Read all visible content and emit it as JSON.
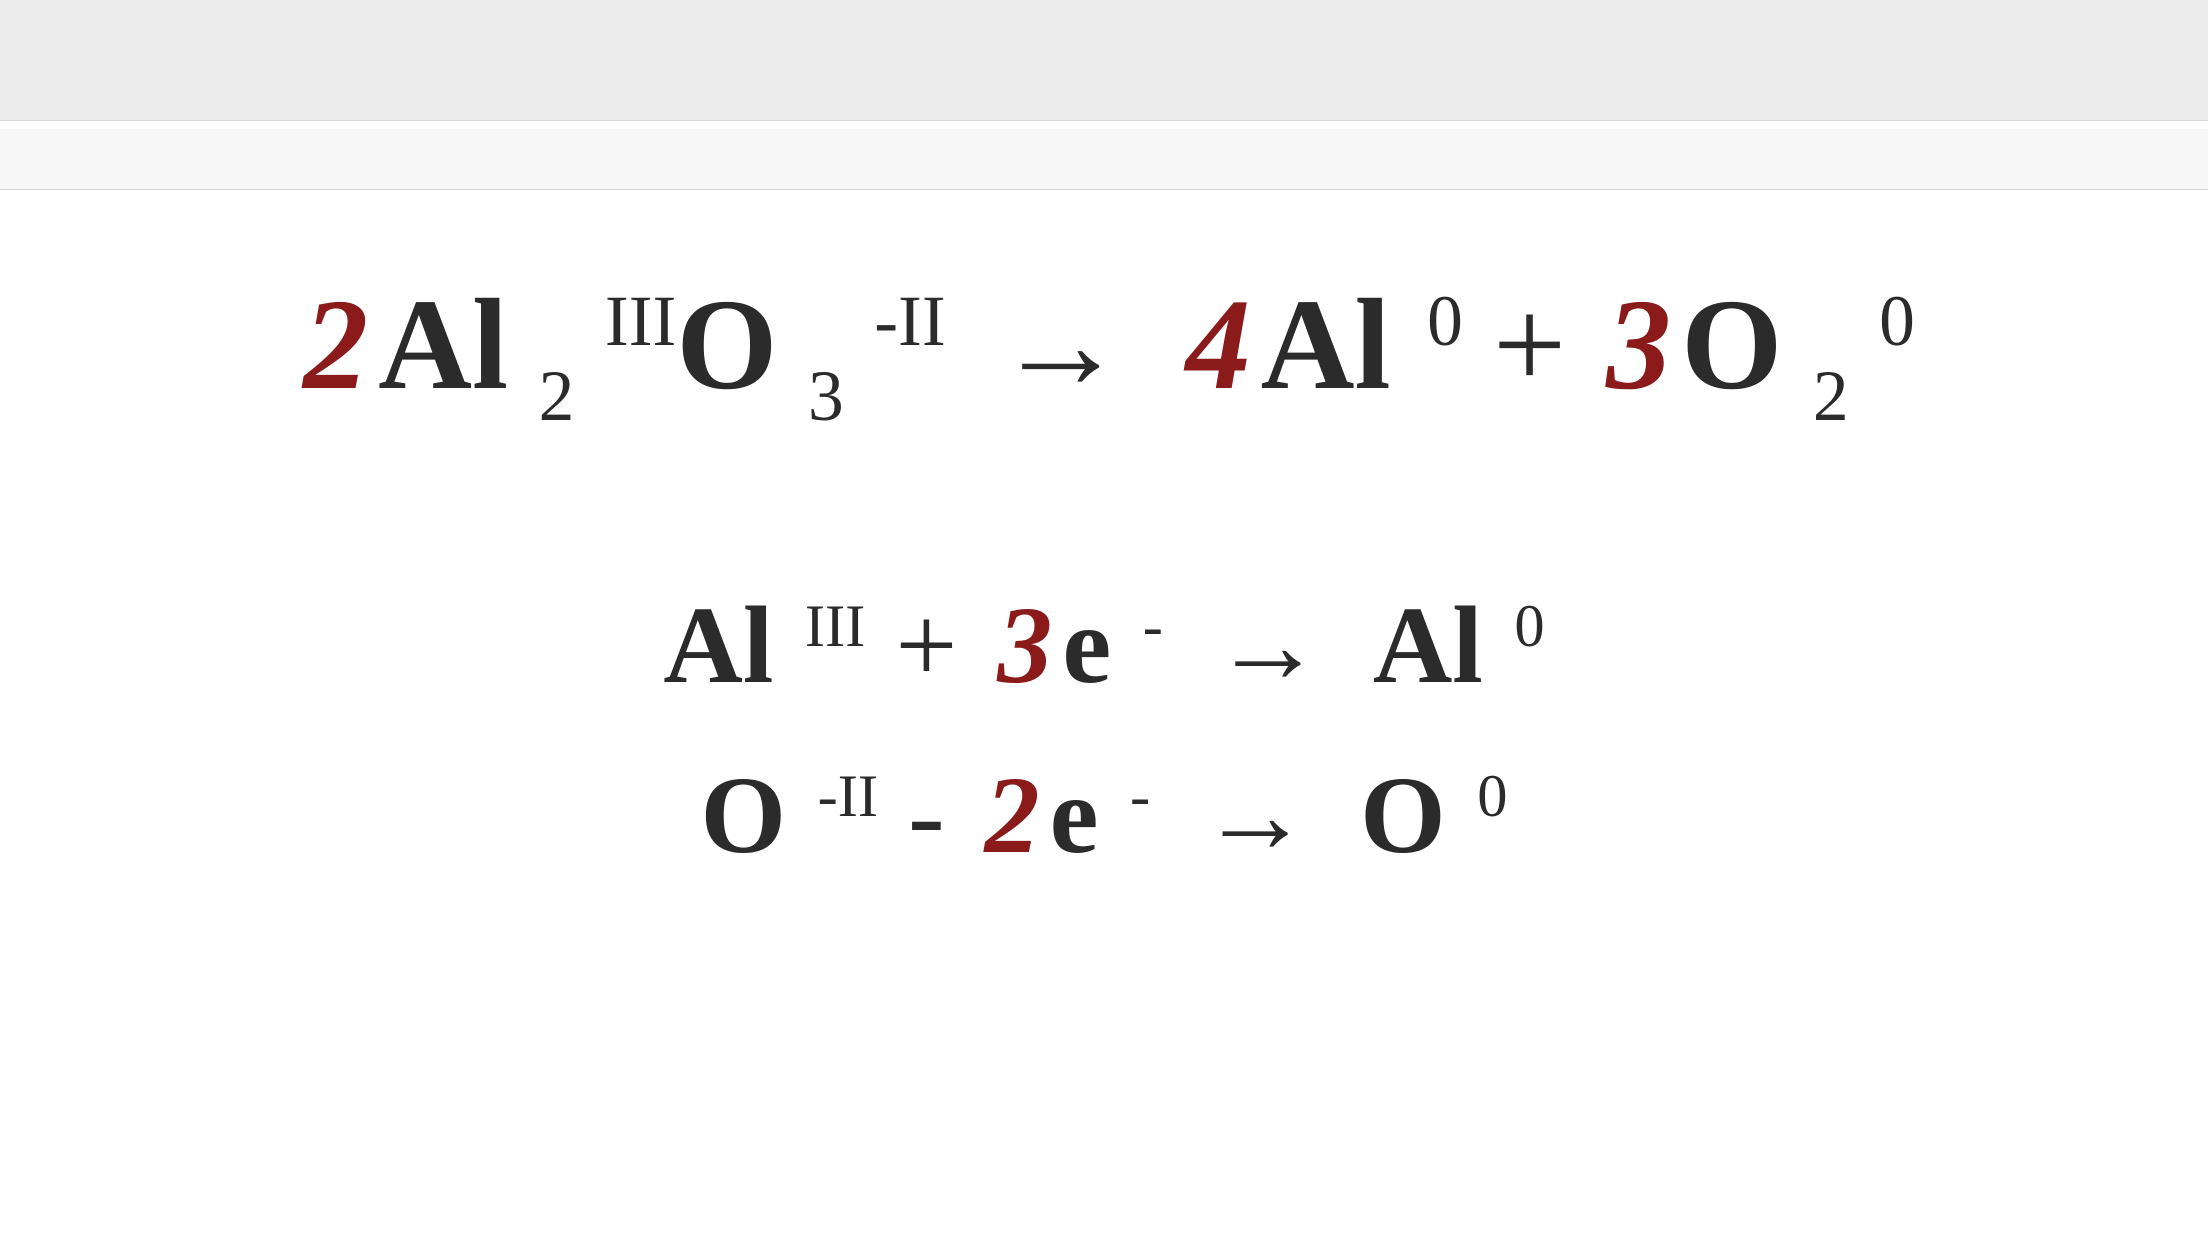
{
  "colors": {
    "coefficient": "#8b1a1a",
    "text": "#2b2b2b"
  },
  "equation_main": {
    "c1": "2",
    "t1": {
      "el": "Al",
      "sub": "2",
      "sup": "III"
    },
    "t2": {
      "el": "O",
      "sub": "3",
      "sup": "-II"
    },
    "arrow": "→",
    "c2": "4",
    "t3": {
      "el": "Al",
      "sup": "0"
    },
    "plus": "+",
    "c3": "3",
    "t4": {
      "el": "O",
      "sub": "2",
      "sup": "0"
    }
  },
  "half_reduction": {
    "t1": {
      "el": "Al",
      "sup": "III"
    },
    "plus": "+",
    "c1": "3",
    "t2": {
      "el": "e",
      "sup": "-"
    },
    "arrow": "→",
    "t3": {
      "el": "Al",
      "sup": "0"
    }
  },
  "half_oxidation": {
    "t1": {
      "el": "O",
      "sup": "-II"
    },
    "minus": "-",
    "c1": "2",
    "t2": {
      "el": "e",
      "sup": "-"
    },
    "arrow": "→",
    "t3": {
      "el": "O",
      "sup": "0"
    }
  }
}
